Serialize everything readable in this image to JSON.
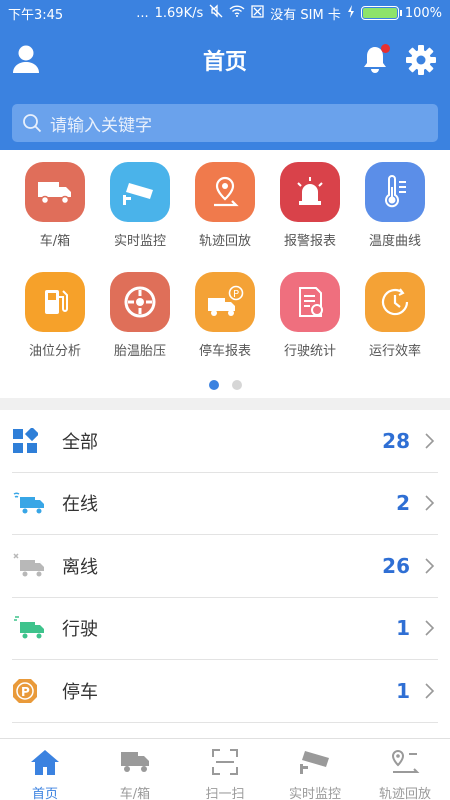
{
  "status_bar": {
    "time": "下午3:45",
    "dots": "...",
    "speed": "1.69K/s",
    "network": "没有 SIM 卡",
    "battery": "100%"
  },
  "header": {
    "title": "首页",
    "notification_dot_color": "#e82f2f",
    "bg_color": "#3b82e0"
  },
  "search": {
    "placeholder": "请输入关键字"
  },
  "functions": [
    {
      "label": "车/箱",
      "icon": "truck-icon",
      "color": "#e06e5a"
    },
    {
      "label": "实时监控",
      "icon": "camera-icon",
      "color": "#4ab3ea"
    },
    {
      "label": "轨迹回放",
      "icon": "location-pin-icon",
      "color": "#f07a4c"
    },
    {
      "label": "报警报表",
      "icon": "alarm-siren-icon",
      "color": "#d9424a"
    },
    {
      "label": "温度曲线",
      "icon": "thermometer-icon",
      "color": "#5b8ee8"
    },
    {
      "label": "油位分析",
      "icon": "fuel-pump-icon",
      "color": "#f6a12a"
    },
    {
      "label": "胎温胎压",
      "icon": "tire-icon",
      "color": "#df6f59"
    },
    {
      "label": "停车报表",
      "icon": "parking-truck-icon",
      "color": "#f4a236"
    },
    {
      "label": "行驶统计",
      "icon": "report-stats-icon",
      "color": "#ef6f7e"
    },
    {
      "label": "运行效率",
      "icon": "clock-efficiency-icon",
      "color": "#f4a236"
    }
  ],
  "pagination": {
    "current": 1,
    "total": 2
  },
  "summary": [
    {
      "label": "全部",
      "count": "28",
      "icon": "grid-all-icon"
    },
    {
      "label": "在线",
      "count": "2",
      "icon": "truck-online-icon"
    },
    {
      "label": "离线",
      "count": "26",
      "icon": "truck-offline-icon"
    },
    {
      "label": "行驶",
      "count": "1",
      "icon": "truck-driving-icon"
    },
    {
      "label": "停车",
      "count": "1",
      "icon": "parking-icon"
    }
  ],
  "tabs": [
    {
      "label": "首页",
      "icon": "home-icon",
      "active": true
    },
    {
      "label": "车/箱",
      "icon": "truck-tab-icon",
      "active": false
    },
    {
      "label": "扫一扫",
      "icon": "scan-icon",
      "active": false
    },
    {
      "label": "实时监控",
      "icon": "camera-tab-icon",
      "active": false
    },
    {
      "label": "轨迹回放",
      "icon": "route-tab-icon",
      "active": false
    }
  ]
}
